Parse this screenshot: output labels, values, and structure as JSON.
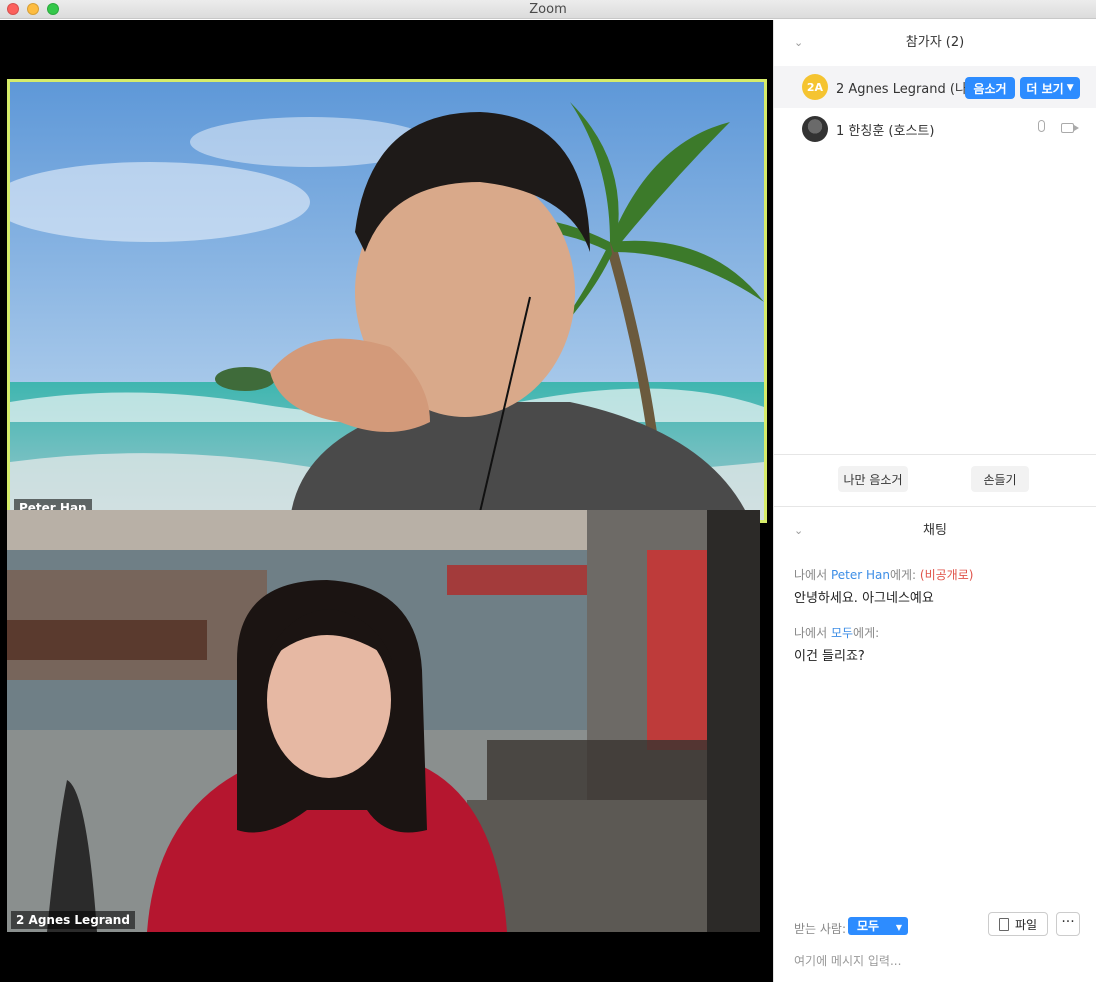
{
  "window": {
    "title": "Zoom",
    "traffic_lights": {
      "close": "#fc605c",
      "minimize": "#fdbc40",
      "zoom": "#34c84a"
    }
  },
  "video": {
    "tiles": [
      {
        "name": "Peter Han",
        "active_speaker": true,
        "border_color": "#d6ec6a",
        "background": "beach-virtual-background"
      },
      {
        "name": "2 Agnes Legrand",
        "active_speaker": false,
        "background": "canal-harbor-virtual-background"
      }
    ]
  },
  "participants": {
    "header": "참가자 (2)",
    "list": [
      {
        "avatar_text": "2A",
        "name": "2 Agnes Legrand (나)",
        "mute_label": "음소거",
        "more_label": "더 보기"
      },
      {
        "name": "1 한칭훈 (호스트)",
        "icons": [
          "microphone-icon",
          "video-camera-icon"
        ]
      }
    ],
    "actions": {
      "mute_me": "나만 음소거",
      "raise_hand": "손들기"
    }
  },
  "chat": {
    "header": "채팅",
    "messages": [
      {
        "from": "나에서",
        "to": "Peter Han",
        "to_suffix": "에게:",
        "private_tag": "(비공개로)",
        "text": "안녕하세요. 아그네스예요"
      },
      {
        "from": "나에서",
        "to": "모두",
        "to_suffix": "에게:",
        "text": "이건 들리죠?"
      }
    ],
    "recipient_label": "받는 사람:",
    "recipient_value": "모두",
    "file_label": "파일",
    "more_label": "···",
    "input_placeholder": "여기에 메시지 입력..."
  },
  "colors": {
    "accent": "#2d8cff",
    "private": "#e0534a",
    "name_link": "#3d8ee6",
    "avatar_yellow": "#f5c431"
  }
}
